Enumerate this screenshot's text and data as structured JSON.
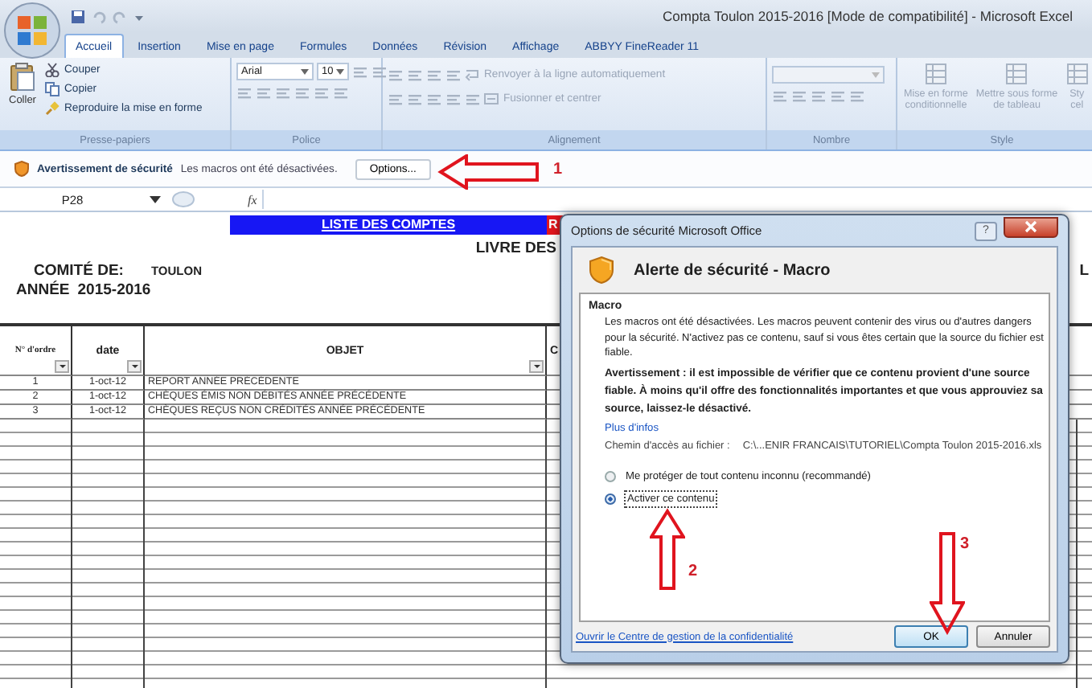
{
  "window": {
    "title": "Compta Toulon 2015-2016  [Mode de compatibilité] - Microsoft Excel"
  },
  "ribbon": {
    "tabs": [
      {
        "label": "Accueil",
        "selected": true
      },
      {
        "label": "Insertion",
        "selected": false
      },
      {
        "label": "Mise en page",
        "selected": false
      },
      {
        "label": "Formules",
        "selected": false
      },
      {
        "label": "Données",
        "selected": false
      },
      {
        "label": "Révision",
        "selected": false
      },
      {
        "label": "Affichage",
        "selected": false
      },
      {
        "label": "ABBYY FineReader 11",
        "selected": false
      }
    ],
    "groups": [
      {
        "kind": "clipboard",
        "label": "Presse-papiers",
        "big": "Coller",
        "items": [
          {
            "label": "Couper",
            "disabled": false
          },
          {
            "label": "Copier",
            "disabled": false
          },
          {
            "label": "Reproduire la mise en forme",
            "disabled": false
          }
        ]
      },
      {
        "kind": "font",
        "label": "Police",
        "font": "Arial",
        "size": "10"
      },
      {
        "kind": "alignment",
        "label": "Alignement",
        "items": [
          {
            "label": "Renvoyer à la ligne automatiquement",
            "disabled": true
          },
          {
            "label": "Fusionner et centrer",
            "disabled": true
          }
        ]
      },
      {
        "kind": "number",
        "label": "Nombre"
      },
      {
        "kind": "style",
        "label": "Style",
        "big": [
          {
            "lines": [
              "Mise en forme",
              "conditionnelle"
            ]
          },
          {
            "lines": [
              "Mettre sous forme",
              "de tableau"
            ]
          },
          {
            "lines": [
              "Sty",
              "cel"
            ]
          }
        ]
      }
    ]
  },
  "security_bar": {
    "title": "Avertissement de sécurité",
    "message": "Les macros ont été désactivées.",
    "button": "Options..."
  },
  "formula_bar": {
    "name_box": "P28",
    "function_label": "fx"
  },
  "sheet": {
    "banner": "LISTE DES COMPTES",
    "banner_2": "R",
    "heading": "LIVRE DES",
    "edge_text": "L",
    "committee_label": "COMITÉ DE:",
    "committee": "TOULON",
    "year_label": "ANNÉE",
    "year": "2015-2016",
    "columns": [
      "N° d'ordre",
      "date",
      "OBJET",
      "C"
    ],
    "rows": [
      [
        "1",
        "1-oct-12",
        "REPORT ANNÉE PRÉCÉDENTE"
      ],
      [
        "2",
        "1-oct-12",
        "CHÈQUES ÉMIS NON DÉBITÉS ANNÉE PRÉCÉDENTE"
      ],
      [
        "3",
        "1-oct-12",
        "CHÈQUES REÇUS NON CRÉDITÉS ANNÉE PRÉCÉDENTE"
      ]
    ]
  },
  "dialog": {
    "title": "Options de sécurité Microsoft Office",
    "help_button": "?",
    "heading": "Alerte de sécurité - Macro",
    "section": "Macro",
    "body": "Les macros ont été désactivées. Les macros peuvent contenir des virus ou d'autres dangers pour la sécurité. N'activez pas ce contenu, sauf si vous êtes certain que la source du fichier est fiable.",
    "warning": "Avertissement : il est impossible de vérifier que ce contenu provient d'une source fiable. À moins qu'il offre des fonctionnalités importantes et que vous approuviez sa source, laissez-le désactivé.",
    "link": "Plus d'infos",
    "path_label": "Chemin d'accès au fichier :",
    "path": "C:\\...ENIR FRANCAIS\\TUTORIEL\\Compta Toulon 2015-2016.xls",
    "options": [
      {
        "label": "Me protéger de tout contenu inconnu (recommandé)",
        "selected": false
      },
      {
        "label": "Activer ce contenu",
        "selected": true
      }
    ],
    "footer_link": "Ouvrir le Centre de gestion de la confidentialité",
    "buttons": [
      "OK",
      "Annuler"
    ]
  },
  "annotations": [
    {
      "kind": "left",
      "number": "1"
    },
    {
      "kind": "up",
      "number": "2"
    },
    {
      "kind": "down",
      "number": "3"
    }
  ]
}
